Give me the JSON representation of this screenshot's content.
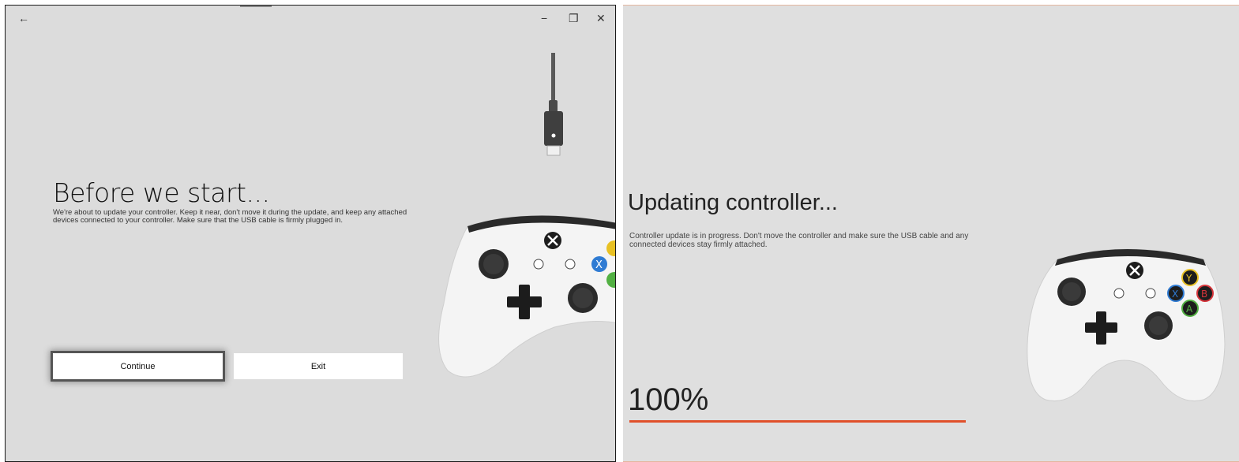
{
  "left_window": {
    "back_icon": "←",
    "minimize_icon": "−",
    "restore_icon": "❐",
    "close_icon": "✕",
    "heading": "Before we start...",
    "description": "We're about to update your controller. Keep it near, don't move it during the update, and keep any attached devices connected to your controller. Make sure that the USB cable is firmly plugged in.",
    "continue_label": "Continue",
    "exit_label": "Exit"
  },
  "right_window": {
    "heading": "Updating controller...",
    "description": "Controller update is in progress. Don't move the controller and make sure the USB cable and any connected devices stay firmly attached.",
    "percent_label": "100%",
    "progress": 1.0
  },
  "colors": {
    "accent": "#e0502a",
    "background": "#dcdcdc",
    "xbox_green": "#3aa334",
    "button_y": "#e8c124",
    "button_b": "#d6343a",
    "button_x": "#2f7bd3",
    "button_a": "#52b043"
  },
  "icons": [
    "back-arrow-icon",
    "minimize-icon",
    "restore-icon",
    "close-icon",
    "usb-cable-icon",
    "xbox-controller-icon"
  ]
}
